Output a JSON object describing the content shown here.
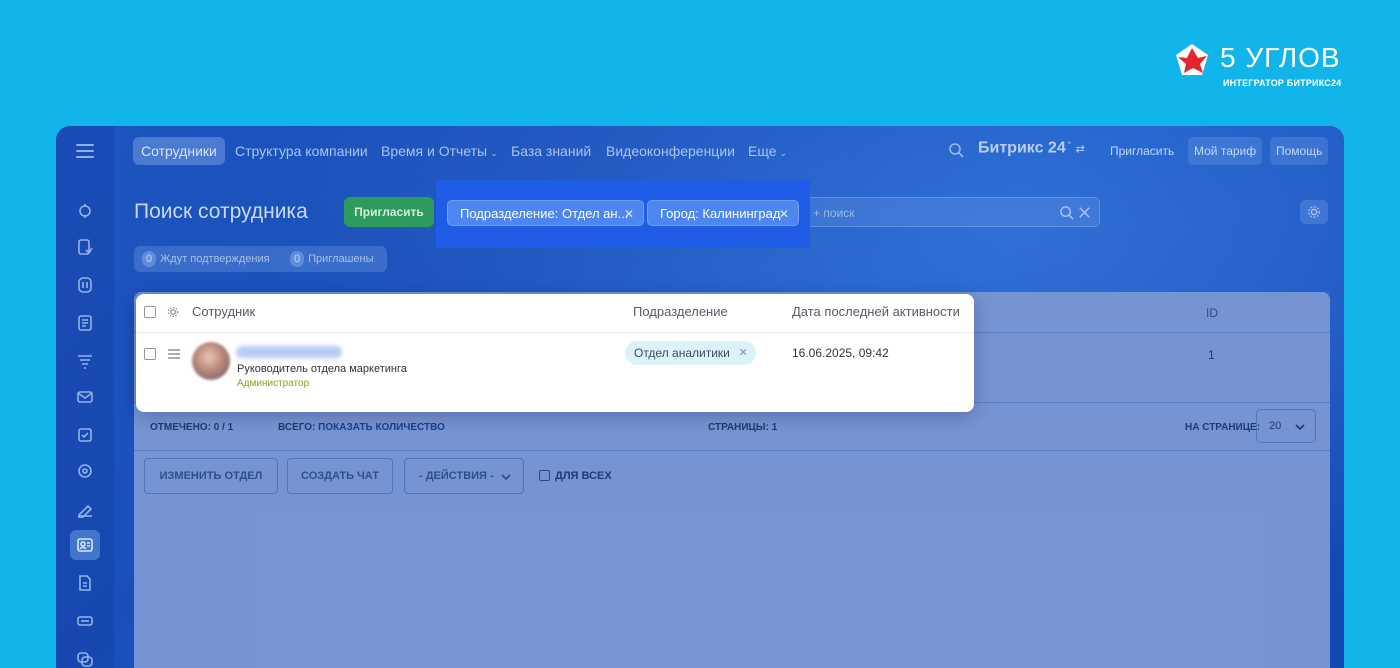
{
  "brand": {
    "name": "5 УГЛОВ",
    "subtitle": "ИНТЕГРАТОР БИТРИКС24"
  },
  "topnav": {
    "items": [
      {
        "label": "Сотрудники",
        "active": true
      },
      {
        "label": "Структура компании"
      },
      {
        "label": "Время и Отчеты",
        "chevron": "⌄"
      },
      {
        "label": "База знаний"
      },
      {
        "label": "Видеоконференции"
      },
      {
        "label": "Еще",
        "chevron": "⌄"
      }
    ],
    "product": "Битрикс 24",
    "right": [
      {
        "label": "Пригласить"
      },
      {
        "label": "Мой тариф"
      },
      {
        "label": "Помощь"
      }
    ]
  },
  "header": {
    "title": "Поиск сотрудника",
    "invite_label": "Пригласить",
    "search_placeholder": "+ поиск"
  },
  "filters": [
    {
      "label": "Подразделение: Отдел ан..."
    },
    {
      "label": "Город: Калининград"
    }
  ],
  "counters": [
    {
      "count": "0",
      "label": "Ждут подтверждения"
    },
    {
      "count": "0",
      "label": "Приглашены"
    }
  ],
  "table": {
    "columns": {
      "employee": "Сотрудник",
      "department": "Подразделение",
      "last_activity": "Дата последней активности",
      "id": "ID"
    },
    "rows": [
      {
        "title": "Руководитель отдела маркетинга",
        "role": "Администратор",
        "department": "Отдел аналитики",
        "last_activity": "16.06.2025, 09:42",
        "id": "1"
      }
    ]
  },
  "footer": {
    "marked_label": "ОТМЕЧЕНО:",
    "marked_value": "0 / 1",
    "total_label": "ВСЕГО:",
    "total_link": "ПОКАЗАТЬ КОЛИЧЕСТВО",
    "pages_label": "СТРАНИЦЫ:",
    "pages_value": "1",
    "per_page_label": "НА СТРАНИЦЕ:",
    "per_page_value": "20"
  },
  "actions": {
    "change_dept": "ИЗМЕНИТЬ ОТДЕЛ",
    "create_chat": "СОЗДАТЬ ЧАТ",
    "actions_select": "- ДЕЙСТВИЯ -",
    "for_all": "ДЛЯ ВСЕХ"
  },
  "colors": {
    "background": "#12b5ea",
    "accent_green": "#2e9a5d",
    "filter_highlight": "#1f5de6",
    "role_green": "#80a91e"
  }
}
